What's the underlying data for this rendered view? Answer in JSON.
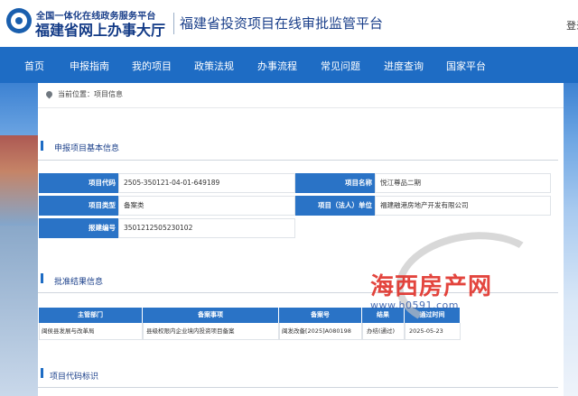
{
  "header": {
    "logo_small": "全国一体化在线政务服务平台",
    "logo_big": "福建省网上办事大厅",
    "site_title": "福建省投资项目在线审批监管平台",
    "login": "登录"
  },
  "nav": [
    "首页",
    "申报指南",
    "我的项目",
    "政策法规",
    "办事流程",
    "常见问题",
    "进度查询",
    "国家平台"
  ],
  "breadcrumb": "当前位置：项目信息",
  "basic_info": {
    "section_title": "申报项目基本信息",
    "project_code_label": "项目代码",
    "project_code": "2505-350121-04-01-649189",
    "project_name_label": "项目名称",
    "project_name": "悦江尊品二期",
    "project_type_label": "项目类型",
    "project_type": "备案类",
    "legal_unit_label": "项目（法人）单位",
    "legal_unit": "福建融港房地产开发有限公司",
    "report_no_label": "报建编号",
    "report_no": "3501212505230102"
  },
  "approval": {
    "section_title": "批准结果信息",
    "headers": [
      "主管部门",
      "备案事项",
      "备案号",
      "结果",
      "通过时间"
    ],
    "row": [
      "闽侯县发展与改革局",
      "县级权限内企业境内投资项目备案",
      "闽发改备[2025]A080198",
      "办结(通过)",
      "2025-05-23"
    ]
  },
  "code_section": {
    "section_title": "项目代码标识"
  },
  "watermark": {
    "brand": "海西房产网",
    "url": "www.h0591.com"
  }
}
